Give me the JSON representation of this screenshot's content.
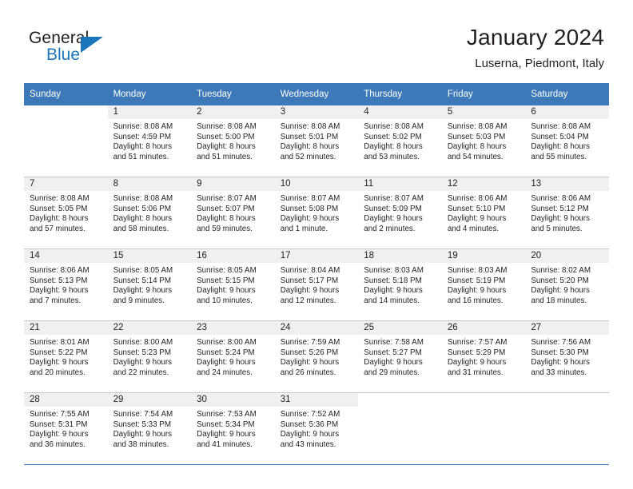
{
  "brand": {
    "name_top": "General",
    "name_bottom": "Blue",
    "flag_icon": "triangle-flag-icon",
    "color_primary": "#1b75bb"
  },
  "header": {
    "title": "January 2024",
    "subtitle": "Luserna, Piedmont, Italy"
  },
  "theme": {
    "header_blue": "#3d78b8",
    "daynum_band": "#f0f0f0",
    "grid_line": "#c8c8c8",
    "text": "#231f20"
  },
  "calendar": {
    "weekday_headers": [
      "Sunday",
      "Monday",
      "Tuesday",
      "Wednesday",
      "Thursday",
      "Friday",
      "Saturday"
    ],
    "weeks": [
      [
        {
          "day": "",
          "sunrise": "",
          "sunset": "",
          "daylight_1": "",
          "daylight_2": ""
        },
        {
          "day": "1",
          "sunrise": "Sunrise: 8:08 AM",
          "sunset": "Sunset: 4:59 PM",
          "daylight_1": "Daylight: 8 hours",
          "daylight_2": "and 51 minutes."
        },
        {
          "day": "2",
          "sunrise": "Sunrise: 8:08 AM",
          "sunset": "Sunset: 5:00 PM",
          "daylight_1": "Daylight: 8 hours",
          "daylight_2": "and 51 minutes."
        },
        {
          "day": "3",
          "sunrise": "Sunrise: 8:08 AM",
          "sunset": "Sunset: 5:01 PM",
          "daylight_1": "Daylight: 8 hours",
          "daylight_2": "and 52 minutes."
        },
        {
          "day": "4",
          "sunrise": "Sunrise: 8:08 AM",
          "sunset": "Sunset: 5:02 PM",
          "daylight_1": "Daylight: 8 hours",
          "daylight_2": "and 53 minutes."
        },
        {
          "day": "5",
          "sunrise": "Sunrise: 8:08 AM",
          "sunset": "Sunset: 5:03 PM",
          "daylight_1": "Daylight: 8 hours",
          "daylight_2": "and 54 minutes."
        },
        {
          "day": "6",
          "sunrise": "Sunrise: 8:08 AM",
          "sunset": "Sunset: 5:04 PM",
          "daylight_1": "Daylight: 8 hours",
          "daylight_2": "and 55 minutes."
        }
      ],
      [
        {
          "day": "7",
          "sunrise": "Sunrise: 8:08 AM",
          "sunset": "Sunset: 5:05 PM",
          "daylight_1": "Daylight: 8 hours",
          "daylight_2": "and 57 minutes."
        },
        {
          "day": "8",
          "sunrise": "Sunrise: 8:08 AM",
          "sunset": "Sunset: 5:06 PM",
          "daylight_1": "Daylight: 8 hours",
          "daylight_2": "and 58 minutes."
        },
        {
          "day": "9",
          "sunrise": "Sunrise: 8:07 AM",
          "sunset": "Sunset: 5:07 PM",
          "daylight_1": "Daylight: 8 hours",
          "daylight_2": "and 59 minutes."
        },
        {
          "day": "10",
          "sunrise": "Sunrise: 8:07 AM",
          "sunset": "Sunset: 5:08 PM",
          "daylight_1": "Daylight: 9 hours",
          "daylight_2": "and 1 minute."
        },
        {
          "day": "11",
          "sunrise": "Sunrise: 8:07 AM",
          "sunset": "Sunset: 5:09 PM",
          "daylight_1": "Daylight: 9 hours",
          "daylight_2": "and 2 minutes."
        },
        {
          "day": "12",
          "sunrise": "Sunrise: 8:06 AM",
          "sunset": "Sunset: 5:10 PM",
          "daylight_1": "Daylight: 9 hours",
          "daylight_2": "and 4 minutes."
        },
        {
          "day": "13",
          "sunrise": "Sunrise: 8:06 AM",
          "sunset": "Sunset: 5:12 PM",
          "daylight_1": "Daylight: 9 hours",
          "daylight_2": "and 5 minutes."
        }
      ],
      [
        {
          "day": "14",
          "sunrise": "Sunrise: 8:06 AM",
          "sunset": "Sunset: 5:13 PM",
          "daylight_1": "Daylight: 9 hours",
          "daylight_2": "and 7 minutes."
        },
        {
          "day": "15",
          "sunrise": "Sunrise: 8:05 AM",
          "sunset": "Sunset: 5:14 PM",
          "daylight_1": "Daylight: 9 hours",
          "daylight_2": "and 9 minutes."
        },
        {
          "day": "16",
          "sunrise": "Sunrise: 8:05 AM",
          "sunset": "Sunset: 5:15 PM",
          "daylight_1": "Daylight: 9 hours",
          "daylight_2": "and 10 minutes."
        },
        {
          "day": "17",
          "sunrise": "Sunrise: 8:04 AM",
          "sunset": "Sunset: 5:17 PM",
          "daylight_1": "Daylight: 9 hours",
          "daylight_2": "and 12 minutes."
        },
        {
          "day": "18",
          "sunrise": "Sunrise: 8:03 AM",
          "sunset": "Sunset: 5:18 PM",
          "daylight_1": "Daylight: 9 hours",
          "daylight_2": "and 14 minutes."
        },
        {
          "day": "19",
          "sunrise": "Sunrise: 8:03 AM",
          "sunset": "Sunset: 5:19 PM",
          "daylight_1": "Daylight: 9 hours",
          "daylight_2": "and 16 minutes."
        },
        {
          "day": "20",
          "sunrise": "Sunrise: 8:02 AM",
          "sunset": "Sunset: 5:20 PM",
          "daylight_1": "Daylight: 9 hours",
          "daylight_2": "and 18 minutes."
        }
      ],
      [
        {
          "day": "21",
          "sunrise": "Sunrise: 8:01 AM",
          "sunset": "Sunset: 5:22 PM",
          "daylight_1": "Daylight: 9 hours",
          "daylight_2": "and 20 minutes."
        },
        {
          "day": "22",
          "sunrise": "Sunrise: 8:00 AM",
          "sunset": "Sunset: 5:23 PM",
          "daylight_1": "Daylight: 9 hours",
          "daylight_2": "and 22 minutes."
        },
        {
          "day": "23",
          "sunrise": "Sunrise: 8:00 AM",
          "sunset": "Sunset: 5:24 PM",
          "daylight_1": "Daylight: 9 hours",
          "daylight_2": "and 24 minutes."
        },
        {
          "day": "24",
          "sunrise": "Sunrise: 7:59 AM",
          "sunset": "Sunset: 5:26 PM",
          "daylight_1": "Daylight: 9 hours",
          "daylight_2": "and 26 minutes."
        },
        {
          "day": "25",
          "sunrise": "Sunrise: 7:58 AM",
          "sunset": "Sunset: 5:27 PM",
          "daylight_1": "Daylight: 9 hours",
          "daylight_2": "and 29 minutes."
        },
        {
          "day": "26",
          "sunrise": "Sunrise: 7:57 AM",
          "sunset": "Sunset: 5:29 PM",
          "daylight_1": "Daylight: 9 hours",
          "daylight_2": "and 31 minutes."
        },
        {
          "day": "27",
          "sunrise": "Sunrise: 7:56 AM",
          "sunset": "Sunset: 5:30 PM",
          "daylight_1": "Daylight: 9 hours",
          "daylight_2": "and 33 minutes."
        }
      ],
      [
        {
          "day": "28",
          "sunrise": "Sunrise: 7:55 AM",
          "sunset": "Sunset: 5:31 PM",
          "daylight_1": "Daylight: 9 hours",
          "daylight_2": "and 36 minutes."
        },
        {
          "day": "29",
          "sunrise": "Sunrise: 7:54 AM",
          "sunset": "Sunset: 5:33 PM",
          "daylight_1": "Daylight: 9 hours",
          "daylight_2": "and 38 minutes."
        },
        {
          "day": "30",
          "sunrise": "Sunrise: 7:53 AM",
          "sunset": "Sunset: 5:34 PM",
          "daylight_1": "Daylight: 9 hours",
          "daylight_2": "and 41 minutes."
        },
        {
          "day": "31",
          "sunrise": "Sunrise: 7:52 AM",
          "sunset": "Sunset: 5:36 PM",
          "daylight_1": "Daylight: 9 hours",
          "daylight_2": "and 43 minutes."
        },
        {
          "day": "",
          "sunrise": "",
          "sunset": "",
          "daylight_1": "",
          "daylight_2": ""
        },
        {
          "day": "",
          "sunrise": "",
          "sunset": "",
          "daylight_1": "",
          "daylight_2": ""
        },
        {
          "day": "",
          "sunrise": "",
          "sunset": "",
          "daylight_1": "",
          "daylight_2": ""
        }
      ]
    ]
  }
}
